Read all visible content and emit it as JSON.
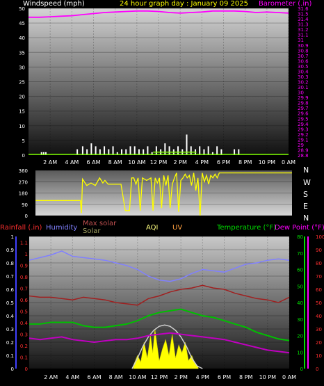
{
  "header": {
    "left_label": "Windspeed (mph)",
    "title": "24 hour graph day : January 09 2025",
    "right_label": "Barometer (.in)"
  },
  "compass": [
    "N",
    "W",
    "S",
    "E",
    "N"
  ],
  "legend": {
    "rainfall": "Rainfall (.in)",
    "humidity": "Humidity",
    "max_solar": "Max solar",
    "solar": "Solar",
    "aqi": "AQI",
    "uv": "UV",
    "temperature": "Temperature (°F)",
    "dew_point": "Dew Point (°F)"
  },
  "colors": {
    "wind": "#ffffff",
    "gust": "#7fff00",
    "barometer": "#ff00ff",
    "direction": "#ffff00",
    "rain": "#4040ff",
    "humidity": "#8080ff",
    "max_solar": "#d0d0d0",
    "solar": "#ffff00",
    "solar_legend": "#a0a060",
    "uv": "#ffa040",
    "aqi": "#ffff80",
    "temperature": "#00e000",
    "dew_point": "#ff00ff",
    "red_axis": "#ff3030",
    "humidity_line": "#8080ff",
    "temperature_line": "#00c000",
    "dew_line": "#c000c0",
    "red_line": "#a02020"
  },
  "chart_data": [
    {
      "type": "line",
      "categories": [
        "2 AM",
        "4 AM",
        "6 AM",
        "8 AM",
        "10 AM",
        "12 PM",
        "2 PM",
        "4 PM",
        "6 PM",
        "8 PM",
        "10 PM",
        "0 AM"
      ],
      "left_axis": {
        "ticks": [
          "0",
          "5",
          "10",
          "15",
          "20",
          "25",
          "30",
          "35",
          "40",
          "45",
          "50"
        ],
        "ylim": [
          0,
          50
        ]
      },
      "right_axis": {
        "ticks": [
          "28.8",
          "28.9",
          "29",
          "29.1",
          "29.2",
          "29.3",
          "29.4",
          "29.5",
          "29.6",
          "29.7",
          "29.8",
          "29.9",
          "30",
          "30.1",
          "30.2",
          "30.3",
          "30.4",
          "30.5",
          "30.6",
          "30.7",
          "30.8",
          "30.9",
          "31",
          "31.1",
          "31.2",
          "31.3",
          "31.4",
          "31.5",
          "31.6"
        ],
        "ylim": [
          28.8,
          31.6
        ]
      },
      "xlim": [
        0,
        24
      ],
      "series": [
        {
          "key": "barometer",
          "x": [
            0,
            1,
            2,
            3,
            4,
            5,
            6,
            7,
            8,
            9,
            10,
            11,
            12,
            13,
            14,
            15,
            16,
            17,
            18,
            19,
            20,
            21,
            22,
            23,
            24
          ],
          "values": [
            31.43,
            31.43,
            31.44,
            31.45,
            31.46,
            31.48,
            31.5,
            31.52,
            31.53,
            31.54,
            31.55,
            31.55,
            31.54,
            31.52,
            31.51,
            31.52,
            31.53,
            31.55,
            31.55,
            31.55,
            31.54,
            31.52,
            31.53,
            31.52,
            31.51
          ]
        },
        {
          "key": "wind",
          "x": [
            1.2,
            1.4,
            1.6,
            4.5,
            5.0,
            5.4,
            5.8,
            6.2,
            6.6,
            7.0,
            7.4,
            7.8,
            8.2,
            8.6,
            9.0,
            9.4,
            9.8,
            10.2,
            10.6,
            11.0,
            11.4,
            11.8,
            12.2,
            12.6,
            13.0,
            13.4,
            13.8,
            14.2,
            14.6,
            15.0,
            15.4,
            15.8,
            16.2,
            16.6,
            17.0,
            17.4,
            17.8,
            19.0,
            19.4
          ],
          "values": [
            1,
            1,
            1,
            2,
            3,
            2,
            4,
            3,
            2,
            3,
            2,
            3,
            1,
            2,
            2,
            3,
            3,
            2,
            2,
            3,
            1,
            3,
            2,
            4,
            3,
            2,
            3,
            2,
            7,
            3,
            2,
            3,
            2,
            3,
            1,
            3,
            2,
            2,
            2
          ]
        },
        {
          "key": "gust",
          "x": [
            11.5,
            12.0,
            12.5,
            13.0,
            13.5,
            14.0,
            14.5,
            15.0,
            15.5
          ],
          "values": [
            1,
            1,
            1,
            1,
            1,
            1,
            1,
            1,
            1
          ]
        }
      ]
    },
    {
      "type": "line",
      "categories": [
        "2 AM",
        "4 AM",
        "6 AM",
        "8 AM",
        "10 AM",
        "12 PM",
        "2 PM",
        "4 PM",
        "6 PM",
        "8 PM",
        "10 PM",
        "0 AM"
      ],
      "left_axis": {
        "ticks": [
          "0",
          "90",
          "180",
          "270",
          "360"
        ],
        "ylim": [
          0,
          360
        ]
      },
      "xlim": [
        0,
        24
      ],
      "series": [
        {
          "key": "direction",
          "x": [
            0,
            4.2,
            4.3,
            4.4,
            4.8,
            5.2,
            5.6,
            6.0,
            6.3,
            6.5,
            6.8,
            7.2,
            7.6,
            8.0,
            8.4,
            8.8,
            9.0,
            9.2,
            9.4,
            9.6,
            9.8,
            10.0,
            10.4,
            10.8,
            11.0,
            11.2,
            11.4,
            11.6,
            11.8,
            12.0,
            12.2,
            12.4,
            12.6,
            12.8,
            13.0,
            13.2,
            13.4,
            13.6,
            13.8,
            14.0,
            14.2,
            14.4,
            14.6,
            14.8,
            15.0,
            15.2,
            15.4,
            15.6,
            15.8,
            16.0,
            16.2,
            16.4,
            16.6,
            16.8,
            17.0,
            17.2,
            17.4,
            17.6,
            18.0,
            18.4,
            18.8,
            19.2,
            19.6,
            20.0,
            20.4,
            20.8,
            21.2,
            21.6,
            22.0,
            22.4,
            22.8,
            23.2,
            23.6,
            24.0
          ],
          "values": [
            120,
            120,
            20,
            290,
            240,
            260,
            240,
            300,
            260,
            280,
            250,
            250,
            250,
            250,
            40,
            40,
            300,
            300,
            250,
            300,
            40,
            300,
            280,
            300,
            40,
            300,
            260,
            300,
            60,
            320,
            240,
            320,
            60,
            250,
            300,
            340,
            30,
            280,
            300,
            330,
            300,
            320,
            240,
            340,
            200,
            300,
            0,
            340,
            270,
            320,
            250,
            320,
            300,
            330,
            300,
            340,
            340,
            340,
            340,
            340,
            340,
            340,
            340,
            340,
            340,
            340,
            340,
            340,
            340,
            340,
            340,
            340,
            340,
            340
          ]
        }
      ]
    },
    {
      "type": "line",
      "categories": [
        "2 AM",
        "4 AM",
        "6 AM",
        "8 AM",
        "10 AM",
        "12 PM",
        "2 PM",
        "4 PM",
        "6 PM",
        "8 PM",
        "10 PM",
        "0 AM"
      ],
      "xlim": [
        0,
        24
      ],
      "axes": {
        "rainfall": {
          "ticks": [
            "0",
            "0.1",
            "0.2",
            "0.3",
            "0.4",
            "0.5",
            "0.6",
            "0.7",
            "0.8",
            "0.9",
            "1"
          ],
          "ylim": [
            0,
            1
          ]
        },
        "humidity": {
          "ticks": [
            "0",
            "10",
            "20",
            "30",
            "40",
            "50",
            "60",
            "70",
            "80",
            "90",
            "100"
          ],
          "ylim": [
            0,
            100
          ]
        },
        "red_scale": {
          "ticks": [
            "0",
            "0.1",
            "0.2",
            "0.3",
            "0.4",
            "0.5",
            "0.6",
            "0.7",
            "0.8",
            "0.9",
            "1",
            "1.1"
          ],
          "ylim": [
            0,
            1.15
          ]
        },
        "temperature": {
          "ticks": [
            "0",
            "10",
            "20",
            "30",
            "40",
            "50",
            "60",
            "70",
            "80"
          ],
          "ylim": [
            0,
            80
          ]
        },
        "dew_point_scale": {
          "ticks": [
            "0",
            "10",
            "20",
            "30",
            "40",
            "50",
            "60",
            "70",
            "80",
            "90",
            "100"
          ],
          "ylim": [
            0,
            100
          ]
        }
      },
      "series": [
        {
          "key": "humidity",
          "axis": "humidity",
          "x": [
            0,
            1,
            2,
            3,
            4,
            5,
            6,
            7,
            8,
            9,
            10,
            11,
            12,
            13,
            14,
            15,
            16,
            17,
            18,
            19,
            20,
            21,
            22,
            23,
            24
          ],
          "values": [
            82,
            84,
            86,
            89,
            85,
            84,
            83,
            82,
            80,
            78,
            75,
            70,
            67,
            66,
            68,
            72,
            75,
            74,
            73,
            76,
            79,
            80,
            82,
            83,
            82
          ]
        },
        {
          "key": "red_line",
          "axis": "humidity",
          "x": [
            0,
            1,
            2,
            3,
            4,
            5,
            6,
            7,
            8,
            9,
            10,
            11,
            12,
            13,
            14,
            15,
            16,
            17,
            18,
            19,
            20,
            21,
            22,
            23,
            24
          ],
          "values": [
            55,
            54,
            54,
            53,
            52,
            54,
            53,
            52,
            50,
            49,
            48,
            53,
            55,
            58,
            60,
            61,
            63,
            61,
            60,
            57,
            55,
            53,
            52,
            50,
            54
          ]
        },
        {
          "key": "temperature",
          "axis": "temperature",
          "x": [
            0,
            1,
            2,
            3,
            4,
            5,
            6,
            7,
            8,
            9,
            10,
            11,
            12,
            13,
            14,
            15,
            16,
            17,
            18,
            19,
            20,
            21,
            22,
            23,
            24
          ],
          "values": [
            27,
            27,
            28,
            28,
            28,
            26,
            25,
            25,
            26,
            27,
            29,
            32,
            34,
            35,
            36,
            34,
            32,
            31,
            29,
            27,
            25,
            22,
            20,
            18,
            17
          ]
        },
        {
          "key": "dew_point",
          "axis": "dew_point_scale",
          "x": [
            0,
            1,
            2,
            3,
            4,
            5,
            6,
            7,
            8,
            9,
            10,
            11,
            12,
            13,
            14,
            15,
            16,
            17,
            18,
            19,
            20,
            21,
            22,
            23,
            24
          ],
          "values": [
            23,
            22,
            23,
            24,
            22,
            21,
            20,
            21,
            22,
            22,
            23,
            25,
            26,
            27,
            26,
            25,
            24,
            23,
            22,
            20,
            18,
            16,
            14,
            13,
            12
          ]
        },
        {
          "key": "max_solar",
          "axis": "humidity",
          "x": [
            9.5,
            10.0,
            10.5,
            11.0,
            11.5,
            12.0,
            12.5,
            13.0,
            13.5,
            14.0,
            14.5,
            15.0,
            15.5,
            16.0
          ],
          "values": [
            0,
            8,
            17,
            24,
            29,
            32,
            33,
            32,
            29,
            24,
            17,
            8,
            2,
            0
          ]
        },
        {
          "key": "solar",
          "axis": "humidity",
          "x": [
            9.6,
            10.0,
            10.3,
            10.6,
            10.9,
            11.2,
            11.4,
            11.6,
            11.8,
            12.0,
            12.3,
            12.6,
            12.9,
            13.2,
            13.5,
            13.8,
            14.1,
            14.4,
            14.7,
            15.0,
            15.3,
            15.6
          ],
          "values": [
            2,
            10,
            5,
            20,
            8,
            25,
            12,
            30,
            18,
            6,
            15,
            22,
            10,
            26,
            8,
            18,
            12,
            20,
            6,
            10,
            4,
            1
          ]
        }
      ]
    }
  ]
}
